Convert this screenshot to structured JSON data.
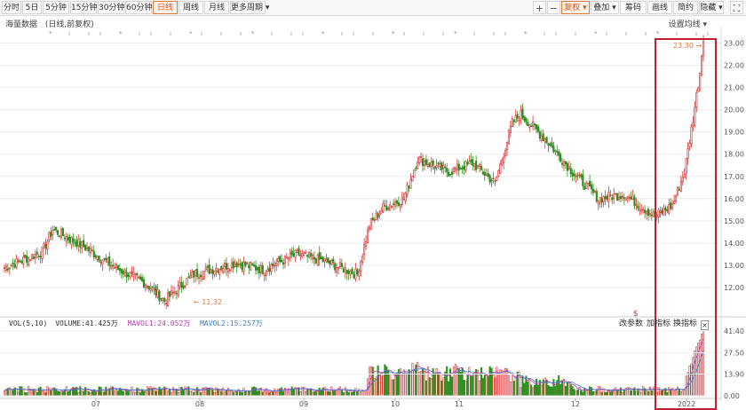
{
  "toolbar": {
    "periods": [
      "分时",
      "5日",
      "5分钟",
      "15分钟",
      "30分钟",
      "60分钟",
      "日线",
      "周线",
      "月线",
      "更多周期"
    ],
    "active_period": "日线",
    "right_buttons": [
      "复权",
      "叠加",
      "筹码",
      "画线",
      "简约",
      "隐藏"
    ],
    "active_right": "复权",
    "icons": [
      "plus-icon",
      "minus-icon",
      "fullscreen-icon"
    ]
  },
  "chart_header": {
    "title": "海量数据",
    "subtitle": "(日线,前复权)",
    "ma_settings": "设置均线"
  },
  "price_axis": {
    "ticks": [
      "23.00",
      "22.00",
      "21.00",
      "20.00",
      "19.00",
      "18.00",
      "17.00",
      "16.00",
      "15.00",
      "14.00",
      "13.00",
      "12.00"
    ]
  },
  "annotations": {
    "low_label": "11.32",
    "high_label": "23.30"
  },
  "indicator": {
    "name": "VOL(5,10)",
    "volume": "VOLUME:41.425万",
    "mavol1": "MAVOL1:24.052万",
    "mavol2": "MAVOL2:15.257万",
    "buttons": [
      "改参数",
      "加指标",
      "换指标"
    ],
    "ticks": [
      "41.40",
      "27.50",
      "13.90",
      "0.00"
    ]
  },
  "time_axis": {
    "labels": [
      "07",
      "08",
      "09",
      "10",
      "11",
      "12",
      "2022"
    ]
  },
  "colors": {
    "up": "#d9393b",
    "down": "#2f8f1f",
    "accent": "#e07a3a",
    "highlight": "#c0202a",
    "mavol1": "#c03ab8",
    "mavol2": "#3a7ed1"
  },
  "chart_data": {
    "type": "candlestick",
    "ylim": [
      11,
      23.5
    ],
    "volume_ylim": [
      0,
      41.4
    ],
    "x": [
      "07",
      "08",
      "09",
      "10",
      "11",
      "12",
      "2022"
    ]
  }
}
